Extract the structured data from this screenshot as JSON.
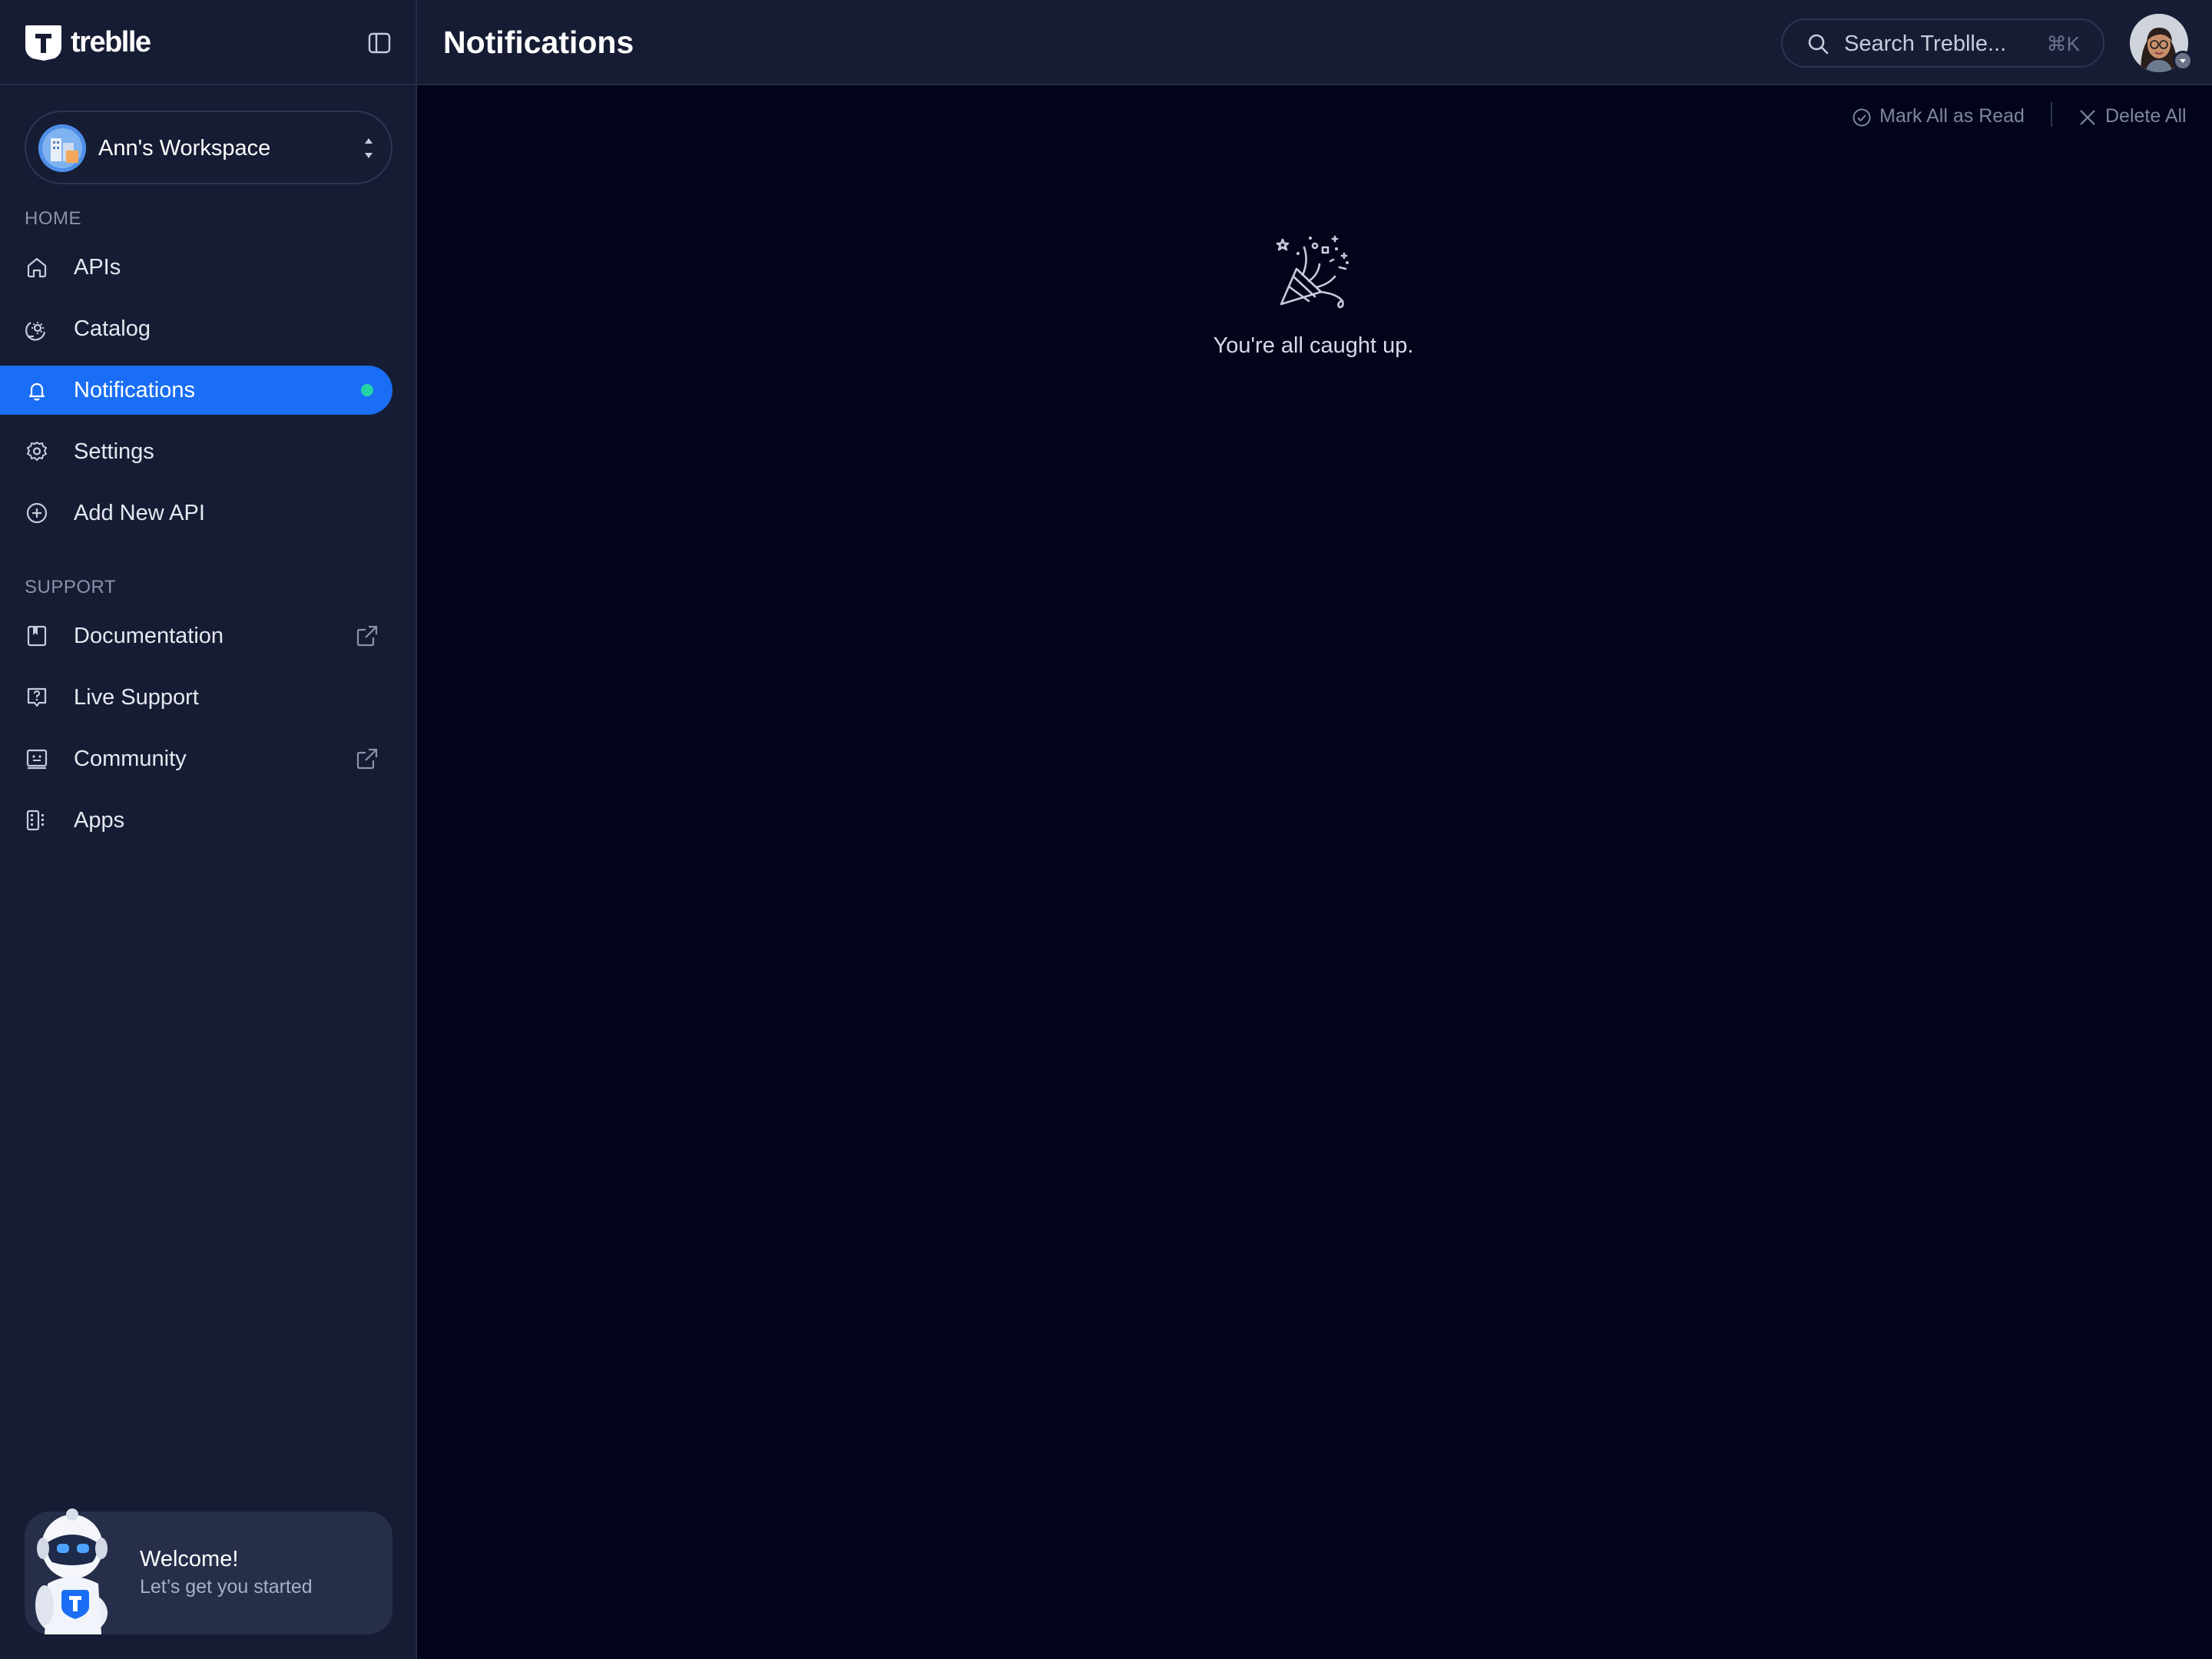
{
  "brand": {
    "name": "treblle"
  },
  "workspace": {
    "name": "Ann's Workspace"
  },
  "sidebar": {
    "home_label": "HOME",
    "home_items": [
      {
        "label": "APIs",
        "icon": "home-icon"
      },
      {
        "label": "Catalog",
        "icon": "catalog-icon"
      },
      {
        "label": "Notifications",
        "icon": "bell-icon",
        "active": true,
        "unread": true
      },
      {
        "label": "Settings",
        "icon": "gear-icon"
      },
      {
        "label": "Add New API",
        "icon": "plus-circle-icon"
      }
    ],
    "support_label": "SUPPORT",
    "support_items": [
      {
        "label": "Documentation",
        "icon": "book-icon",
        "external": true
      },
      {
        "label": "Live Support",
        "icon": "help-chat-icon"
      },
      {
        "label": "Community",
        "icon": "community-icon",
        "external": true
      },
      {
        "label": "Apps",
        "icon": "apps-icon"
      }
    ],
    "welcome": {
      "title": "Welcome!",
      "subtitle": "Let’s get you started"
    }
  },
  "header": {
    "title": "Notifications",
    "search_placeholder": "Search Treblle...",
    "search_shortcut": "⌘K"
  },
  "actions": {
    "mark_all_read": "Mark All as Read",
    "delete_all": "Delete All"
  },
  "empty_state": {
    "message": "You're all caught up."
  },
  "colors": {
    "accent": "#1a6ef5",
    "sidebar_bg": "#161c33",
    "main_bg": "#02051a",
    "unread_dot": "#22d3a6"
  }
}
